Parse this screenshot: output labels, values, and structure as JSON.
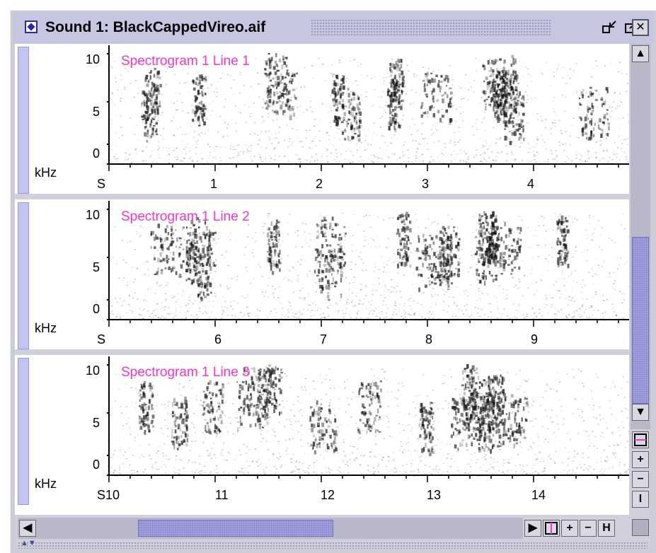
{
  "window": {
    "title": "Sound 1: BlackCappedVireo.aif",
    "minimize_icon": "shrink-arrows-icon",
    "maximize_icon": "expand-arrows-icon",
    "close_icon": "close-x-icon"
  },
  "panels": [
    {
      "label": "Spectrogram 1  Line 1",
      "y_ticks": [
        "10",
        "5",
        "0"
      ],
      "y_unit": "kHz",
      "x_unit": "S",
      "x_ticks": [
        "1",
        "2",
        "3",
        "4"
      ],
      "x_start": "",
      "time_range_s": [
        0,
        4.9
      ],
      "freq_range_khz": [
        0,
        11
      ]
    },
    {
      "label": "Spectrogram 1  Line 2",
      "y_ticks": [
        "10",
        "5",
        "0"
      ],
      "y_unit": "kHz",
      "x_unit": "S",
      "x_ticks": [
        "6",
        "7",
        "8",
        "9"
      ],
      "x_start": "",
      "time_range_s": [
        4.9,
        9.8
      ],
      "freq_range_khz": [
        0,
        11
      ]
    },
    {
      "label": "Spectrogram 1  Line 3",
      "y_ticks": [
        "10",
        "5",
        "0"
      ],
      "y_unit": "kHz",
      "x_unit": "S",
      "x_ticks": [
        "11",
        "12",
        "13",
        "14"
      ],
      "x_start": "10",
      "time_range_s": [
        9.9,
        14.8
      ],
      "freq_range_khz": [
        0,
        11
      ]
    }
  ],
  "vscroll": {
    "up_icon": "arrow-up-icon",
    "down_icon": "arrow-down-icon",
    "zoom_in": "+",
    "zoom_out": "−",
    "fit": "I"
  },
  "hscroll": {
    "left_icon": "arrow-left-icon",
    "right_icon": "arrow-right-icon",
    "zoom_in": "+",
    "zoom_out": "−",
    "fit": "H"
  },
  "colors": {
    "label": "#ff33cc",
    "thumb": "#a8a8e0",
    "strip": "#c4c4f0"
  }
}
